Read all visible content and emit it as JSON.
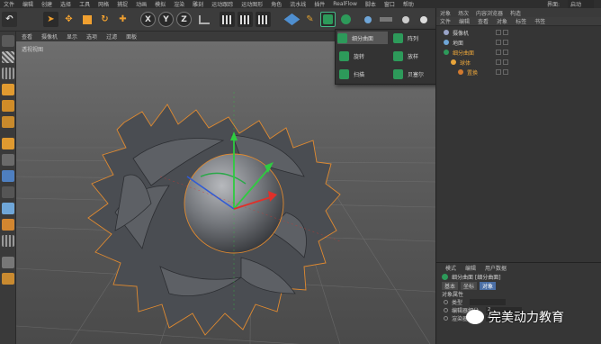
{
  "menubar": {
    "items": [
      "文件",
      "编辑",
      "创建",
      "选择",
      "工具",
      "网格",
      "捕捉",
      "动画",
      "模拟",
      "渲染",
      "雕刻",
      "运动跟踪",
      "运动图形",
      "角色",
      "流水线",
      "插件",
      "RealFlow",
      "脚本",
      "窗口",
      "帮助"
    ],
    "layout_label": "界面:",
    "layout_value": "启动"
  },
  "toolbar": {
    "x_label": "X",
    "y_label": "Y",
    "z_label": "Z"
  },
  "viewport": {
    "menu": [
      "查看",
      "摄像机",
      "显示",
      "选项",
      "过滤",
      "面板"
    ],
    "label": "透视视图"
  },
  "popup": {
    "items": [
      {
        "label": "细分曲面"
      },
      {
        "label": "阵列"
      },
      {
        "label": "旋转"
      },
      {
        "label": "放样"
      },
      {
        "label": "扫描"
      },
      {
        "label": "贝塞尔"
      }
    ]
  },
  "object_manager": {
    "tabs": [
      "对象",
      "场次",
      "内容浏览器",
      "构造"
    ],
    "menu": [
      "文件",
      "编辑",
      "查看",
      "对象",
      "标签",
      "书签"
    ],
    "objects": [
      {
        "name": "摄像机",
        "color": "#9aa4c8",
        "selected": false
      },
      {
        "name": "地面",
        "color": "#6fa6d8",
        "selected": false
      },
      {
        "name": "细分曲面",
        "color": "#2d9a5a",
        "selected": true
      },
      {
        "name": "球体",
        "color": "#e8a43a",
        "selected": true
      },
      {
        "name": "置换",
        "color": "#d27a2f",
        "selected": true
      }
    ]
  },
  "attributes": {
    "menu": [
      "模式",
      "编辑",
      "用户数据"
    ],
    "title": "细分曲面 [细分曲面]",
    "tabs": [
      {
        "label": "基本",
        "active": false
      },
      {
        "label": "坐标",
        "active": false
      },
      {
        "label": "对象",
        "active": true
      }
    ],
    "section": "对象属性",
    "rows": [
      {
        "label": "类型",
        "value": ""
      },
      {
        "label": "编辑器细分",
        "value": "2"
      },
      {
        "label": "渲染器细分",
        "value": "4"
      }
    ]
  },
  "watermark": {
    "text": "完美动力教育"
  }
}
